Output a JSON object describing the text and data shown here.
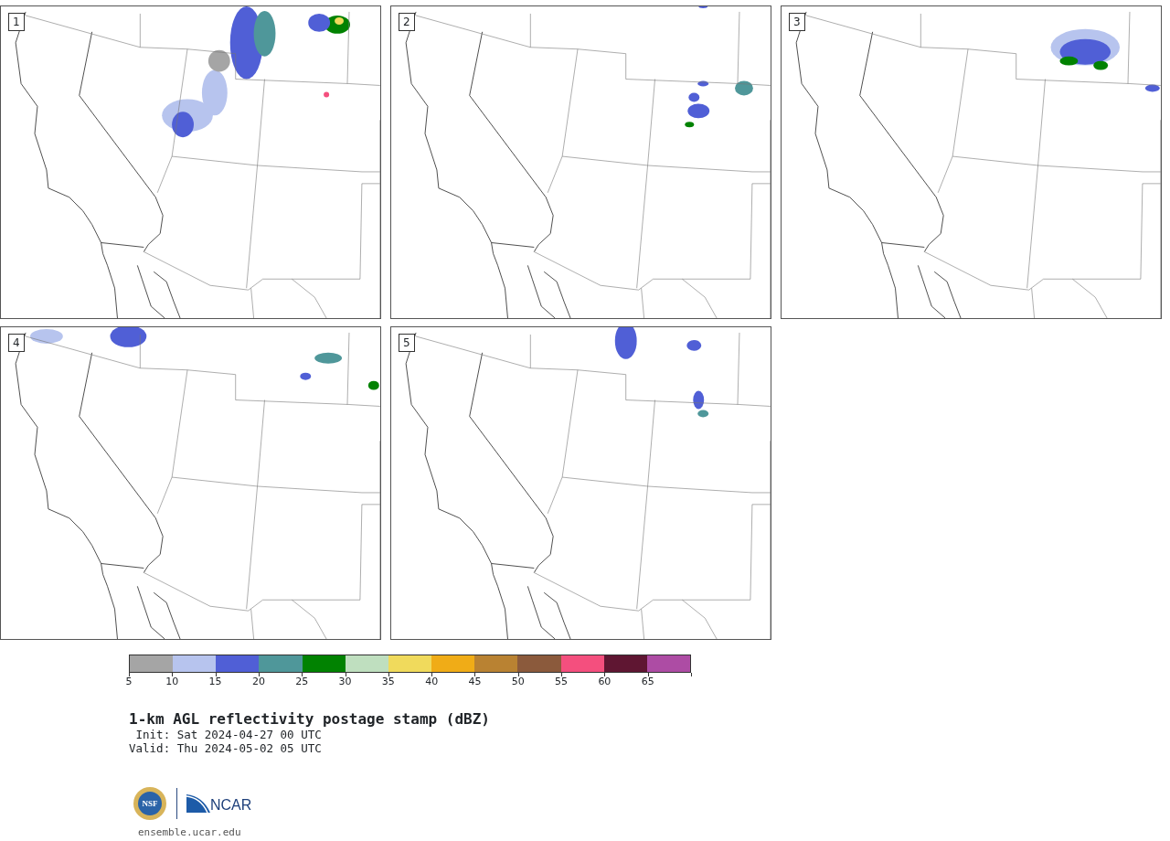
{
  "panels": [
    {
      "label": "1"
    },
    {
      "label": "2"
    },
    {
      "label": "3"
    },
    {
      "label": "4"
    },
    {
      "label": "5"
    }
  ],
  "colorbar": {
    "segments": [
      {
        "color": "#a5a5a5"
      },
      {
        "color": "#b7c4ee"
      },
      {
        "color": "#505fd6"
      },
      {
        "color": "#4f979a"
      },
      {
        "color": "#018201"
      },
      {
        "color": "#bfdfbf"
      },
      {
        "color": "#f0da5c"
      },
      {
        "color": "#f0ac17"
      },
      {
        "color": "#b98232"
      },
      {
        "color": "#8b5a3c"
      },
      {
        "color": "#f44f7e"
      },
      {
        "color": "#5f1632"
      },
      {
        "color": "#ad4ca4"
      }
    ],
    "ticks": [
      "5",
      "10",
      "15",
      "20",
      "25",
      "30",
      "35",
      "40",
      "45",
      "50",
      "55",
      "60",
      "65"
    ]
  },
  "title": "1-km AGL reflectivity postage stamp (dBZ)",
  "init": " Init: Sat 2024-04-27 00 UTC",
  "valid": "Valid: Thu 2024-05-02 05 UTC",
  "logo": {
    "nsf": "NSF",
    "ncar": "NCAR"
  },
  "url": "ensemble.ucar.edu"
}
